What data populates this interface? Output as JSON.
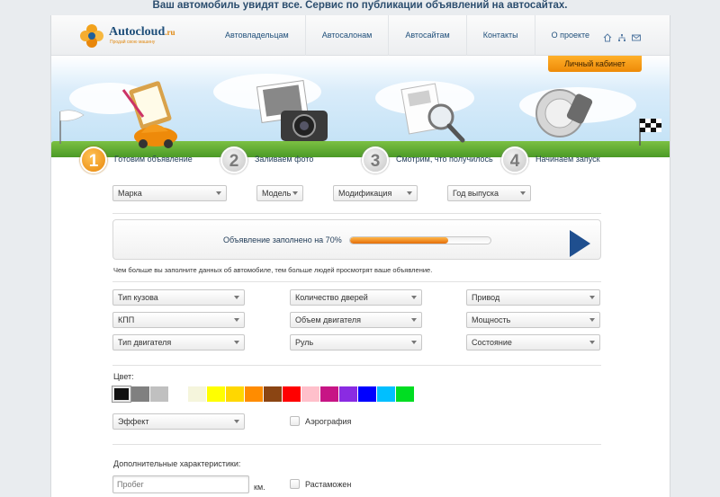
{
  "banner": "Ваш автомобиль увидят все. Сервис по публикации объявлений на автосайтах.",
  "logo": {
    "name": "Autocloud",
    "tld": ".ru",
    "tagline": "Продай свою машину"
  },
  "nav": [
    "Автовладельцам",
    "Автосалонам",
    "Автосайтам",
    "Контакты",
    "О проекте"
  ],
  "header_icons": [
    "home-icon",
    "sitemap-icon",
    "mail-icon"
  ],
  "cabinet_button": "Личный кабинет",
  "steps": [
    {
      "num": "1",
      "label": "Готовим объявление",
      "active": true
    },
    {
      "num": "2",
      "label": "Заливаем фото",
      "active": false
    },
    {
      "num": "3",
      "label": "Смотрим, что получилось",
      "active": false
    },
    {
      "num": "4",
      "label": "Начинаем запуск",
      "active": false
    }
  ],
  "car_selects": [
    "Марка",
    "Модель",
    "Модификация",
    "Год выпуска"
  ],
  "progress": {
    "text": "Объявление заполнено на 70%",
    "percent": 70
  },
  "hint": "Чем больше вы заполните данных об автомобиле, тем больше людей просмотрят ваше объявление.",
  "param_selects": [
    "Тип кузова",
    "Количество дверей",
    "Привод",
    "КПП",
    "Объем двигателя",
    "Мощность",
    "Тип двигателя",
    "Руль",
    "Состояние"
  ],
  "color_label": "Цвет:",
  "colors": [
    "#111111",
    "#808080",
    "#c0c0c0",
    "#ffffff",
    "#f5f5dc",
    "#ffff00",
    "#ffd700",
    "#ff8c00",
    "#8b4513",
    "#ff0000",
    "#ffc0cb",
    "#c71585",
    "#8a2be2",
    "#0000ff",
    "#00bfff",
    "#00dd22"
  ],
  "effect_select": "Эффект",
  "airbrush_label": "Аэрография",
  "extra_label": "Дополнительные характеристики:",
  "mileage_placeholder": "Пробег",
  "mileage_unit": "км.",
  "customs_label": "Растаможен"
}
